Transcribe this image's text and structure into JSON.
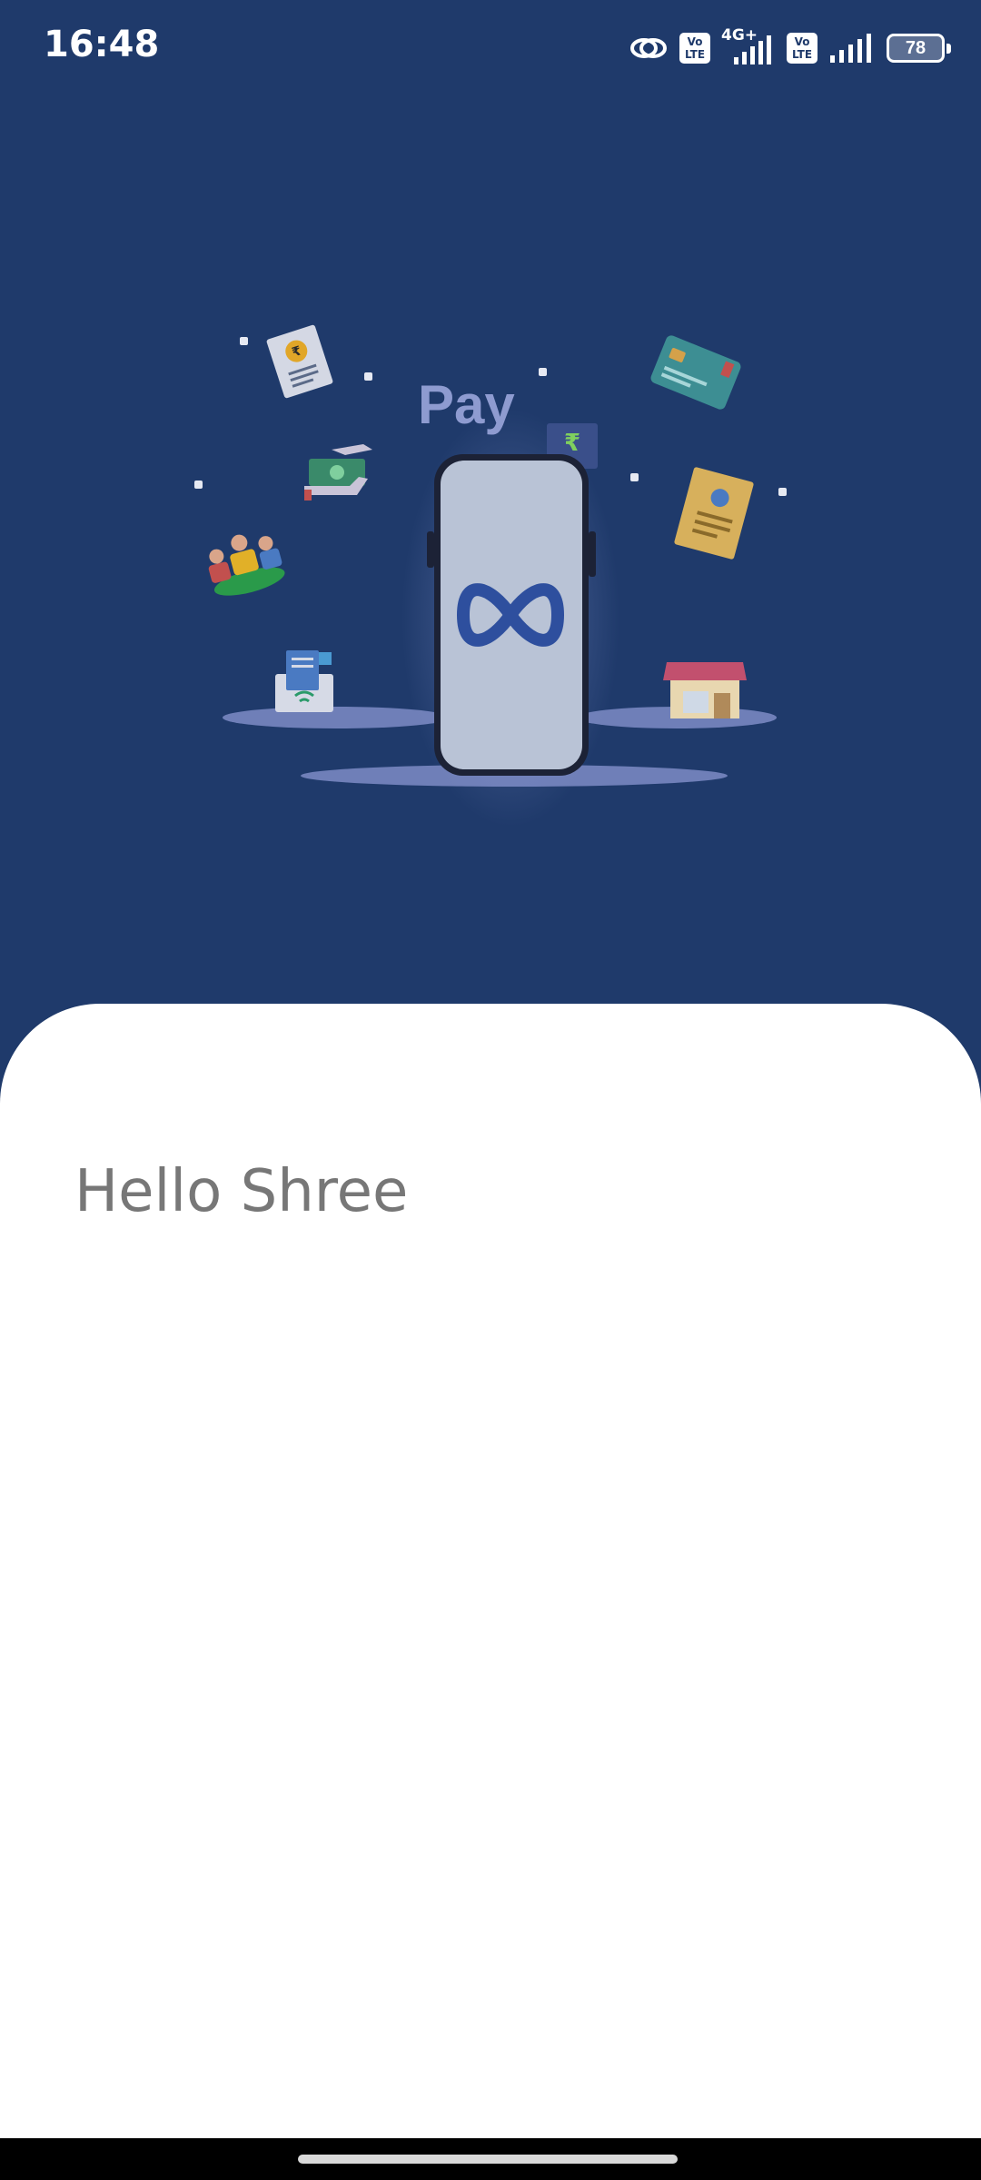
{
  "status_bar": {
    "time": "16:48",
    "network_type": "4G+",
    "volte_label": "Vo LTE",
    "battery_level": "78",
    "icons": [
      "link-icon",
      "volte-icon",
      "signal-icon",
      "volte-icon",
      "signal-icon",
      "battery-icon"
    ]
  },
  "hero": {
    "pay_text": "Pay",
    "icons": [
      "receipt-icon",
      "payment-card-icon",
      "cash-transfer-icon",
      "people-group-icon",
      "bill-icon",
      "document-icon",
      "pos-terminal-icon",
      "store-icon",
      "app-logo-icon",
      "phone-illustration"
    ]
  },
  "content": {
    "greeting": "Hello Shree"
  },
  "colors": {
    "background": "#1f3a6b",
    "sheet": "#ffffff",
    "greeting_text": "#777777"
  }
}
